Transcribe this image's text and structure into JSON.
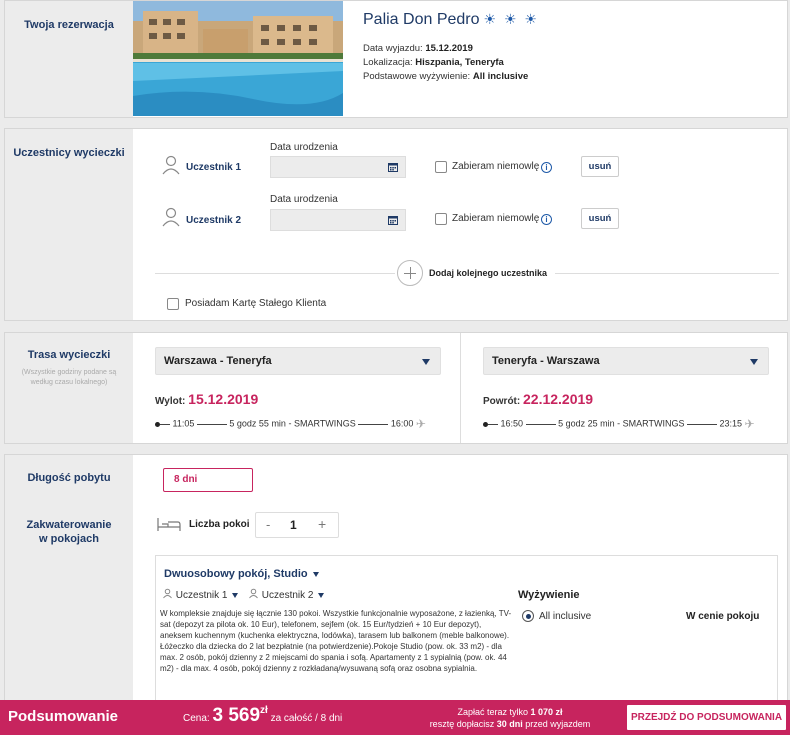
{
  "reservation": {
    "section_label": "Twoja rezerwacja",
    "hotel_name": "Palia Don Pedro",
    "suns": "☀ ☀ ☀",
    "departure_label": "Data wyjazdu:",
    "departure_value": "15.12.2019",
    "location_label": "Lokalizacja:",
    "location_value": "Hiszpania, Teneryfa",
    "board_label": "Podstawowe wyżywienie:",
    "board_value": "All inclusive"
  },
  "participants": {
    "section_label": "Uczestnicy wycieczki",
    "birth_label": "Data urodzenia",
    "infant_label": "Zabieram niemowlę",
    "remove_label": "usuń",
    "list": [
      {
        "name": "Uczestnik 1",
        "birth_value": ""
      },
      {
        "name": "Uczestnik 2",
        "birth_value": ""
      }
    ],
    "add_label": "Dodaj kolejnego uczestnika",
    "card_label": "Posiadam Kartę Stałego Klienta"
  },
  "route": {
    "section_label": "Trasa wycieczki",
    "note": "(Wszystkie godziny podane są według czasu lokalnego)",
    "outbound": {
      "select": "Warszawa - Teneryfa",
      "date_label": "Wylot:",
      "date": "15.12.2019",
      "dep_time": "11:05",
      "duration": "5 godz 55 min",
      "carrier": "SMARTWINGS",
      "arr_time": "16:00"
    },
    "inbound": {
      "select": "Teneryfa - Warszawa",
      "date_label": "Powrót:",
      "date": "22.12.2019",
      "dep_time": "16:50",
      "duration": "5 godz 25 min",
      "carrier": "SMARTWINGS",
      "arr_time": "23:15"
    }
  },
  "stay": {
    "length_label": "Długość pobytu",
    "length_value": "8 dni",
    "rooms_section_label": "Zakwaterowanie w pokojach",
    "rooms_count_label": "Liczba pokoi",
    "rooms_minus": "-",
    "rooms_count": "1",
    "rooms_plus": "+",
    "room": {
      "title": "Dwuosobowy pokój, Studio",
      "participant_1": "Uczestnik 1",
      "participant_2": "Uczestnik 2",
      "description": "W kompleksie znajduje się łącznie 130 pokoi. Wszystkie funkcjonalnie wyposażone, z łazienką, TV-sat (depozyt za pilota ok. 10 Eur), telefonem, sejfem (ok. 15 Eur/tydzień + 10 Eur depozyt), aneksem kuchennym (kuchenka elektryczna, lodówka), tarasem lub balkonem (meble balkonowe). Łóżeczko dla dziecka do 2 lat bezpłatnie (na potwierdzenie).Pokoje Studio (pow. ok. 33 m2) - dla max. 2 osób, pokój dzienny z 2 miejscami do spania i sofą. Apartamenty z 1 sypialnią (pow. ok. 44 m2) - dla max. 4 osób, pokój dzienny z rozkładaną/wysuwaną sofą oraz osobna sypialnia.",
      "board_heading": "Wyżywienie",
      "board_option": "All inclusive",
      "board_price": "W cenie pokoju"
    }
  },
  "summary": {
    "title": "Podsumowanie",
    "price_label": "Cena:",
    "price_value": "3 569",
    "currency": "zł",
    "price_suffix": "za całość / 8 dni",
    "pay_now_text": "Zapłać teraz tylko",
    "pay_now_value": "1 070 zł",
    "rest_text": "resztę dopłacisz",
    "rest_days": "30 dni",
    "rest_suffix": "przed wyjazdem",
    "button_label": "PRZEJDŹ DO PODSUMOWANIA"
  },
  "colors": {
    "brand_navy": "#1f3a66",
    "accent_magenta": "#c7245e",
    "panel_side": "#ececec"
  }
}
